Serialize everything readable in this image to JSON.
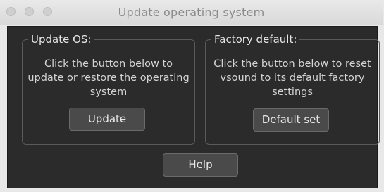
{
  "window": {
    "title": "Update operating system"
  },
  "update_os": {
    "legend": "Update OS:",
    "description": "Click the button below to update or restore the operating system",
    "button_label": "Update"
  },
  "factory_default": {
    "legend": "Factory default:",
    "description": "Click the button below to reset vsound to its default factory settings",
    "button_label": "Default set"
  },
  "footer": {
    "help_label": "Help"
  }
}
